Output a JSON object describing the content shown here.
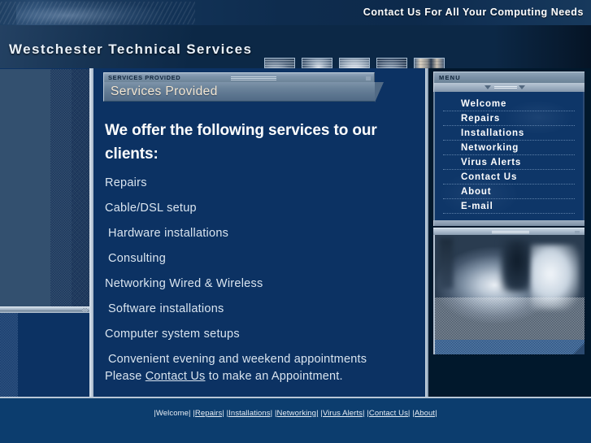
{
  "banner": {
    "tagline": "Contact Us For All Your Computing Needs"
  },
  "masthead": {
    "site_title": "Westchester Technical Services",
    "thumbnails": [
      {
        "name": "thumb-hand-keyboard"
      },
      {
        "name": "thumb-person"
      },
      {
        "name": "thumb-eye-mouse"
      },
      {
        "name": "thumb-abstract-blur"
      },
      {
        "name": "thumb-server-rack"
      }
    ]
  },
  "panel": {
    "eyebrow": "Services Provided",
    "title": "Services Provided"
  },
  "main": {
    "headline": "We offer the following services to our clients:",
    "services": [
      {
        "label": "Repairs",
        "indent": false
      },
      {
        "label": "Cable/DSL setup",
        "indent": false
      },
      {
        "label": "Hardware installations",
        "indent": true
      },
      {
        "label": "Consulting",
        "indent": true
      },
      {
        "label": "Networking  Wired & Wireless",
        "indent": false
      },
      {
        "label": "Software installations",
        "indent": true
      },
      {
        "label": "Computer system setups",
        "indent": false
      }
    ],
    "closing_line_1": "Convenient evening and weekend appointments",
    "closing_before_link": "Please ",
    "closing_link": "Contact Us",
    "closing_after_link": " to make an Appointment."
  },
  "menu": {
    "header": "Menu",
    "items": [
      {
        "label": "Welcome"
      },
      {
        "label": "Repairs"
      },
      {
        "label": "Installations"
      },
      {
        "label": "Networking"
      },
      {
        "label": "Virus Alerts"
      },
      {
        "label": "Contact Us"
      },
      {
        "label": "About"
      },
      {
        "label": "E-mail"
      }
    ]
  },
  "footer": {
    "separator": "|",
    "links": [
      {
        "label": "Welcome",
        "underlined": false
      },
      {
        "label": "Repairs",
        "underlined": true
      },
      {
        "label": "Installations",
        "underlined": true
      },
      {
        "label": "Networking",
        "underlined": true
      },
      {
        "label": "Virus Alerts",
        "underlined": true
      },
      {
        "label": "Contact Us",
        "underlined": true
      },
      {
        "label": "About",
        "underlined": true
      }
    ]
  },
  "colors": {
    "page_background": "#01182c",
    "content_blue": "#0c3263",
    "menu_blue": "#0e3668",
    "footer_blue": "#0c3d6e",
    "steel": "#6c849b",
    "title_cream": "#f3e6d2",
    "text_light": "#d9e4ef",
    "edge_light": "#c2cfdd"
  }
}
